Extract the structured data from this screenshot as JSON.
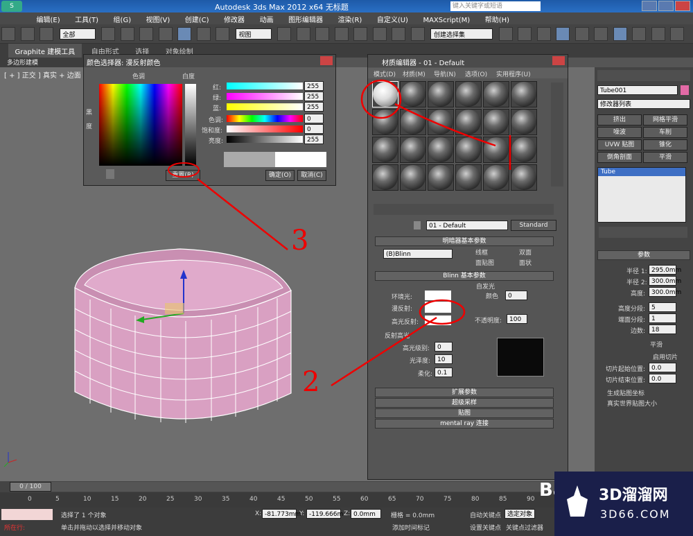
{
  "titlebar": {
    "app_title": "Autodesk 3ds Max  2012 x64    无标题",
    "search_placeholder": "键入关键字或短语"
  },
  "menu": [
    "编辑(E)",
    "工具(T)",
    "组(G)",
    "视图(V)",
    "创建(C)",
    "修改器",
    "动画",
    "图形编辑器",
    "渲染(R)",
    "自定义(U)",
    "MAXScript(M)",
    "帮助(H)"
  ],
  "toolbar": {
    "selection_filter": "全部",
    "coord_system": "视图",
    "named_selection": "创建选择集"
  },
  "ribbon": {
    "tabs": [
      "Graphite 建模工具",
      "自由形式",
      "选择",
      "对象绘制"
    ],
    "sub": "多边形建模"
  },
  "viewport": {
    "label": "[ + ] 正交 ] 真实 + 边面"
  },
  "color_dialog": {
    "title": "颜色选择器: 漫反射颜色",
    "hue_label": "色调",
    "white_label": "白度",
    "black_label": "黑",
    "degree_label": "度",
    "rows": [
      {
        "label": "红:",
        "value": "255"
      },
      {
        "label": "绿:",
        "value": "255"
      },
      {
        "label": "蓝:",
        "value": "255"
      },
      {
        "label": "色调:",
        "value": "0"
      },
      {
        "label": "饱和度:",
        "value": "0"
      },
      {
        "label": "亮度:",
        "value": "255"
      }
    ],
    "reset": "重置(R)",
    "ok": "确定(O)",
    "cancel": "取消(C)"
  },
  "mat_editor": {
    "title": "材质编辑器 - 01 - Default",
    "menu": [
      "模式(D)",
      "材质(M)",
      "导航(N)",
      "选项(O)",
      "实用程序(U)"
    ],
    "material_name": "01 - Default",
    "material_type": "Standard",
    "shader_rollout": "明暗器基本参数",
    "shader": "(B)Blinn",
    "checks": [
      "线框",
      "双面",
      "面贴图",
      "面状"
    ],
    "blinn_rollout": "Blinn 基本参数",
    "self_illum": "自发光",
    "color_label": "颜色",
    "self_illum_value": "0",
    "ambient": "环境光:",
    "diffuse": "漫反射:",
    "specular": "高光反射:",
    "opacity": "不透明度:",
    "opacity_value": "100",
    "spec_group": "反射高光",
    "spec_level": "高光级别:",
    "spec_level_value": "0",
    "gloss": "光泽度:",
    "gloss_value": "10",
    "soften": "柔化:",
    "soften_value": "0.1",
    "rollouts": [
      "扩展参数",
      "超级采样",
      "贴图",
      "mental ray 连接"
    ]
  },
  "cmd_panel": {
    "object_name": "Tube001",
    "modifier_list": "修改器列表",
    "buttons": [
      "挤出",
      "网格平滑",
      "噪波",
      "车削",
      "UVW 贴图",
      "锥化",
      "倒角剖面",
      "平滑"
    ],
    "stack_item": "Tube",
    "params_title": "参数",
    "params": [
      {
        "label": "半径 1:",
        "value": "295.0mm"
      },
      {
        "label": "半径 2:",
        "value": "300.0mm"
      },
      {
        "label": "高度:",
        "value": "300.0mm"
      },
      {
        "label": "高度分段:",
        "value": "5"
      },
      {
        "label": "端面分段:",
        "value": "1"
      },
      {
        "label": "边数:",
        "value": "18"
      }
    ],
    "smooth": "平滑",
    "slice_on": "启用切片",
    "slice_from": "切片起始位置:",
    "slice_to": "切片结束位置:",
    "slice_from_value": "0.0",
    "slice_to_value": "0.0",
    "gen_uv": "生成贴图坐标",
    "real_world": "真实世界贴图大小"
  },
  "timeline": {
    "frame": "0 / 100",
    "ticks": [
      "0",
      "5",
      "10",
      "15",
      "20",
      "25",
      "30",
      "35",
      "40",
      "45",
      "50",
      "55",
      "60",
      "65",
      "70",
      "75",
      "80",
      "85",
      "90"
    ]
  },
  "status": {
    "selected": "选择了 1 个对象",
    "hint": "单击并拖动以选择并移动对象",
    "location": "所在行:",
    "x_label": "X:",
    "x": "-81.773mm",
    "y_label": "Y:",
    "y": "-119.666m",
    "z_label": "Z:",
    "z": "0.0mm",
    "grid": "栅格 = 0.0mm",
    "auto_key": "自动关键点",
    "selected_obj": "选定对象",
    "set_key": "设置关键点",
    "key_filter": "关键点过滤器",
    "add_time_tag": "添加时间标记"
  },
  "watermark": {
    "brand": "3D溜溜网",
    "url": "3D66.COM",
    "bai": "Bai"
  },
  "annotations": [
    "2",
    "3"
  ]
}
